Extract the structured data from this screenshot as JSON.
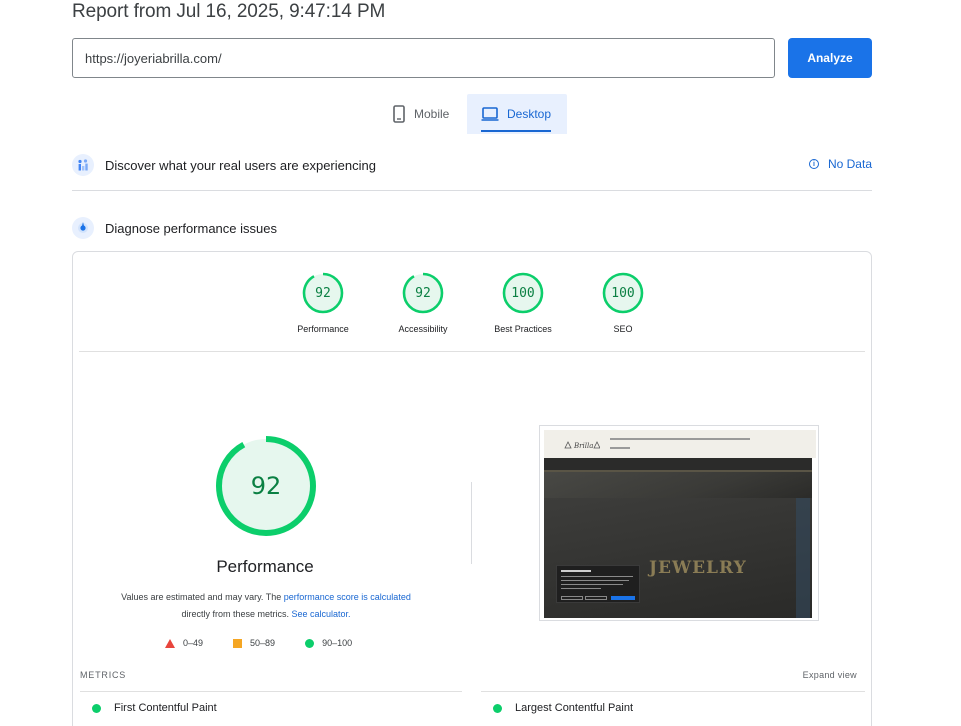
{
  "report": {
    "title": "Report from Jul 16, 2025, 9:47:14 PM"
  },
  "search": {
    "url": "https://joyeriabrilla.com/",
    "analyze_label": "Analyze"
  },
  "tabs": [
    {
      "label": "Mobile",
      "selected": false
    },
    {
      "label": "Desktop",
      "selected": true
    }
  ],
  "sections": {
    "real_users": {
      "title": "Discover what your real users are experiencing",
      "status": "No Data"
    },
    "diagnose": {
      "title": "Diagnose performance issues"
    }
  },
  "scores": [
    {
      "value": "92",
      "label": "Performance",
      "fraction": 0.92
    },
    {
      "value": "92",
      "label": "Accessibility",
      "fraction": 0.92
    },
    {
      "value": "100",
      "label": "Best Practices",
      "fraction": 1.0
    },
    {
      "value": "100",
      "label": "SEO",
      "fraction": 1.0
    }
  ],
  "performance": {
    "score": "92",
    "fraction": 0.92,
    "label": "Performance",
    "desc_part1": "Values are estimated and may vary. The ",
    "desc_link1": "performance score is calculated",
    "desc_part2": " directly from these metrics. ",
    "desc_link2": "See calculator."
  },
  "legend": [
    {
      "range": "0–49",
      "color": "#e8453c"
    },
    {
      "range": "50–89",
      "color": "#f5a623"
    },
    {
      "range": "90–100",
      "color": "#0cce6b"
    }
  ],
  "screenshot": {
    "sign_text": "JEWELRY"
  },
  "metrics": {
    "header": "METRICS",
    "expand_label": "Expand view",
    "items": [
      {
        "label": "First Contentful Paint"
      },
      {
        "label": "Largest Contentful Paint"
      }
    ]
  },
  "colors": {
    "accent": "#1a73e8",
    "pass": "#0cce6b",
    "pass_text": "#0b8043"
  }
}
